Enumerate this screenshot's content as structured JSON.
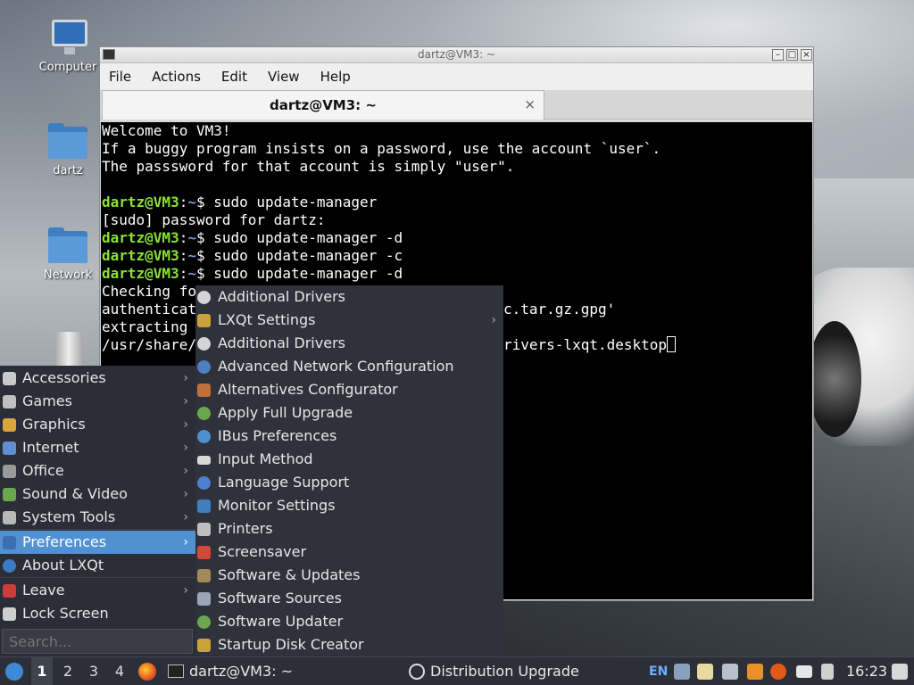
{
  "desktop": {
    "icons": [
      {
        "label": "Computer"
      },
      {
        "label": "dartz"
      },
      {
        "label": "Network"
      },
      {
        "label": ""
      }
    ]
  },
  "terminal": {
    "window_title": "dartz@VM3: ~",
    "menu": [
      "File",
      "Actions",
      "Edit",
      "View",
      "Help"
    ],
    "tab_label": "dartz@VM3: ~",
    "tab_close": "×",
    "prompt_user": "dartz@VM3",
    "prompt_sep": ":",
    "prompt_path": "~",
    "prompt_dollar": "$ ",
    "lines": [
      "Welcome to VM3!",
      "If a buggy program insists on a password, use the account `user`.",
      "The passsword for that account is simply \"user\".",
      "",
      "sudo update-manager",
      "[sudo] password for dartz:",
      "sudo update-manager -d",
      "sudo update-manager -c",
      "sudo update-manager -d",
      "Checking fo",
      "authenticat",
      "extracting",
      "/usr/share/"
    ],
    "line_tail_10": "c.tar.gz.gpg'",
    "line_tail_12": "rivers-lxqt.desktop"
  },
  "start_menu": {
    "items": [
      {
        "label": "Accessories",
        "icon": "accessories-icon",
        "color": "#c9c9c9",
        "submenu": true
      },
      {
        "label": "Games",
        "icon": "games-icon",
        "color": "#bfbfbf",
        "submenu": true
      },
      {
        "label": "Graphics",
        "icon": "graphics-icon",
        "color": "#d9a53c",
        "submenu": true
      },
      {
        "label": "Internet",
        "icon": "internet-icon",
        "color": "#5f8fd0",
        "submenu": true
      },
      {
        "label": "Office",
        "icon": "office-icon",
        "color": "#9a9a9a",
        "submenu": true
      },
      {
        "label": "Sound & Video",
        "icon": "sound-video-icon",
        "color": "#6aa84f",
        "submenu": true
      },
      {
        "label": "System Tools",
        "icon": "system-tools-icon",
        "color": "#b8b8b8",
        "submenu": true
      },
      {
        "label": "Preferences",
        "icon": "preferences-icon",
        "color": "#3b6fb0",
        "submenu": true,
        "highlighted": true
      },
      {
        "label": "About LXQt",
        "icon": "about-icon",
        "color": "#3b7cc4",
        "submenu": false
      },
      {
        "label": "Leave",
        "icon": "leave-icon",
        "color": "#d03b3b",
        "submenu": true
      },
      {
        "label": "Lock Screen",
        "icon": "lock-screen-icon",
        "color": "#cfcfcf",
        "submenu": false
      }
    ],
    "search_placeholder": "Search..."
  },
  "preferences_submenu": {
    "items": [
      {
        "label": "Additional Drivers",
        "icon": "gear-icon",
        "color": "#d4d4d4",
        "submenu": false
      },
      {
        "label": "LXQt Settings",
        "icon": "tools-icon",
        "color": "#c9a23a",
        "submenu": true
      },
      {
        "label": "Additional Drivers",
        "icon": "gear-icon",
        "color": "#d4d4d4",
        "submenu": false
      },
      {
        "label": "Advanced Network Configuration",
        "icon": "network-icon",
        "color": "#4f7fc0",
        "submenu": false
      },
      {
        "label": "Alternatives Configurator",
        "icon": "alternatives-icon",
        "color": "#c0703a",
        "submenu": false
      },
      {
        "label": "Apply Full Upgrade",
        "icon": "upgrade-gear-icon",
        "color": "#6aa84f",
        "submenu": false
      },
      {
        "label": "IBus Preferences",
        "icon": "ibus-gear-icon",
        "color": "#4f8fd0",
        "submenu": false
      },
      {
        "label": "Input Method",
        "icon": "keyboard-icon",
        "color": "#d9d9d9",
        "submenu": false
      },
      {
        "label": "Language Support",
        "icon": "language-icon",
        "color": "#4f7fd0",
        "submenu": false
      },
      {
        "label": "Monitor Settings",
        "icon": "monitor-icon",
        "color": "#3f7fc0",
        "submenu": false
      },
      {
        "label": "Printers",
        "icon": "printer-icon",
        "color": "#bdbdbd",
        "submenu": false
      },
      {
        "label": "Screensaver",
        "icon": "screensaver-icon",
        "color": "#d04a3a",
        "submenu": false
      },
      {
        "label": "Software & Updates",
        "icon": "software-updates-icon",
        "color": "#a08a5a",
        "submenu": false
      },
      {
        "label": "Software Sources",
        "icon": "software-sources-icon",
        "color": "#9aa6b8",
        "submenu": false
      },
      {
        "label": "Software Updater",
        "icon": "updater-gear-icon",
        "color": "#6aa84f",
        "submenu": false
      },
      {
        "label": "Startup Disk Creator",
        "icon": "disk-creator-icon",
        "color": "#c9a23a",
        "submenu": false
      }
    ]
  },
  "taskbar": {
    "desktops": [
      "1",
      "2",
      "3",
      "4"
    ],
    "terminal_task": "dartz@VM3: ~",
    "upgrade_task": "Distribution Upgrade",
    "keyboard_layout": "EN",
    "clock": "16:23"
  }
}
